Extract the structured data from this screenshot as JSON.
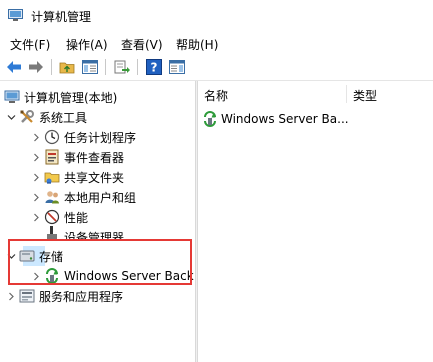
{
  "window": {
    "title": "计算机管理"
  },
  "menu": [
    "文件(F)",
    "操作(A)",
    "查看(V)",
    "帮助(H)"
  ],
  "tree": {
    "root": "计算机管理(本地)",
    "system_tools": "系统工具",
    "task_scheduler": "任务计划程序",
    "event_viewer": "事件查看器",
    "shared_folders": "共享文件夹",
    "local_users": "本地用户和组",
    "performance": "性能",
    "device_manager": "设备管理器",
    "storage": "存储",
    "wsb": "Windows Server Back",
    "services": "服务和应用程序"
  },
  "list": {
    "columns": [
      "名称",
      "类型"
    ],
    "rows": [
      {
        "name": "Windows Server Ba..."
      }
    ]
  },
  "colors": {
    "selection": "#cce8ff",
    "annotation": "#e53935"
  }
}
